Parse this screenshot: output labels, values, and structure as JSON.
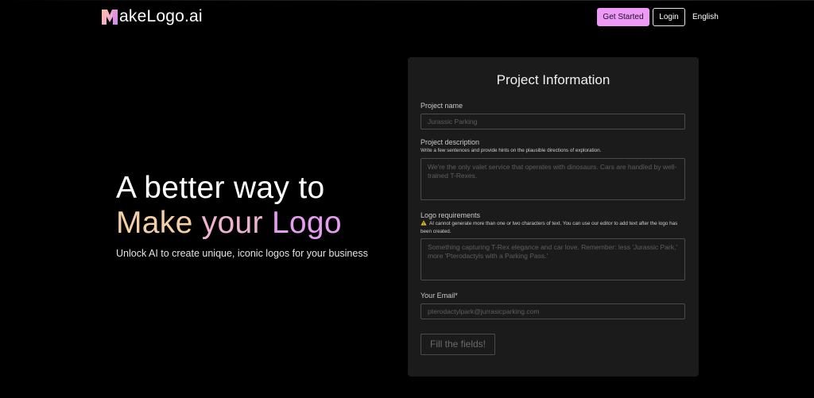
{
  "header": {
    "logo_text": "akeLogo.ai",
    "get_started_label": "Get Started",
    "login_label": "Login",
    "language_label": "English"
  },
  "hero": {
    "line1": "A better way to",
    "line2_word1": "Make",
    "line2_word2": "your",
    "line2_word3": "Logo",
    "subtitle": "Unlock AI to create unique, iconic logos for your business"
  },
  "form": {
    "title": "Project Information",
    "project_name": {
      "label": "Project name",
      "placeholder": "Jurassic Parking"
    },
    "project_description": {
      "label": "Project description",
      "hint": "Write a few sentences and provide hints on the plausible directions of exploration.",
      "placeholder": "We're the only valet service that operates with dinosaurs. Cars are handled by well-trained T-Rexes."
    },
    "logo_requirements": {
      "label": "Logo requirements",
      "warning": "AI cannot generate more than one or two characters of text. You can use our editor to add text after the logo has been created.",
      "placeholder": "Something capturing T-Rex elegance and car love. Remember: less 'Jurassic Park,' more 'Pterodactyls with a Parking Pass.'"
    },
    "email": {
      "label": "Your Email*",
      "placeholder": "pterodactylpark@jurrasicparking.com"
    },
    "submit_label": "Fill the fields!"
  },
  "colors": {
    "accent": "#ef99f7",
    "background": "#000000",
    "panel": "#1b1b1b",
    "gradient_start": "#f4cfa6",
    "gradient_mid": "#efb3d2",
    "gradient_end": "#e79cf2"
  },
  "icons": {
    "logo_mark": "m-logo-mark-icon",
    "warning": "warning-icon"
  }
}
